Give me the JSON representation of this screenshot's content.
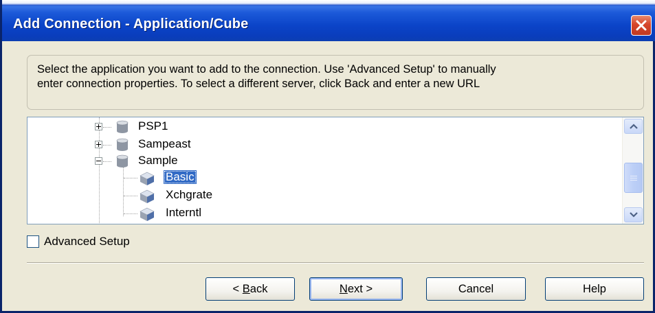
{
  "window": {
    "title": "Add Connection - Application/Cube",
    "close_icon": "close-icon"
  },
  "instructions": {
    "line1": "Select the application you want to add to the connection. Use 'Advanced Setup' to manually",
    "line2": "enter connection properties. To select a different server, click Back and enter a new URL"
  },
  "tree": {
    "nodes": [
      {
        "label": "PSP1",
        "type": "database",
        "expander": "plus",
        "icon": "database-icon"
      },
      {
        "label": "Sampeast",
        "type": "database",
        "expander": "plus",
        "icon": "database-icon"
      },
      {
        "label": "Sample",
        "type": "database",
        "expander": "minus",
        "icon": "database-icon"
      },
      {
        "label": "Basic",
        "type": "cube",
        "selected": true,
        "icon": "cube-icon"
      },
      {
        "label": "Xchgrate",
        "type": "cube",
        "icon": "cube-icon"
      },
      {
        "label": "Interntl",
        "type": "cube",
        "icon": "cube-icon"
      }
    ],
    "selection_color": "#316ac5"
  },
  "advanced_setup": {
    "label": "Advanced Setup",
    "checked": false
  },
  "buttons": {
    "back": {
      "prefix": "< ",
      "mnemonic": "B",
      "rest": "ack"
    },
    "next": {
      "mnemonic": "N",
      "rest": "ext >"
    },
    "cancel": "Cancel",
    "help": "Help"
  },
  "colors": {
    "titlebar": "#0b44c8",
    "dialog_bg": "#ece9d8",
    "close_button": "#d6452a"
  }
}
